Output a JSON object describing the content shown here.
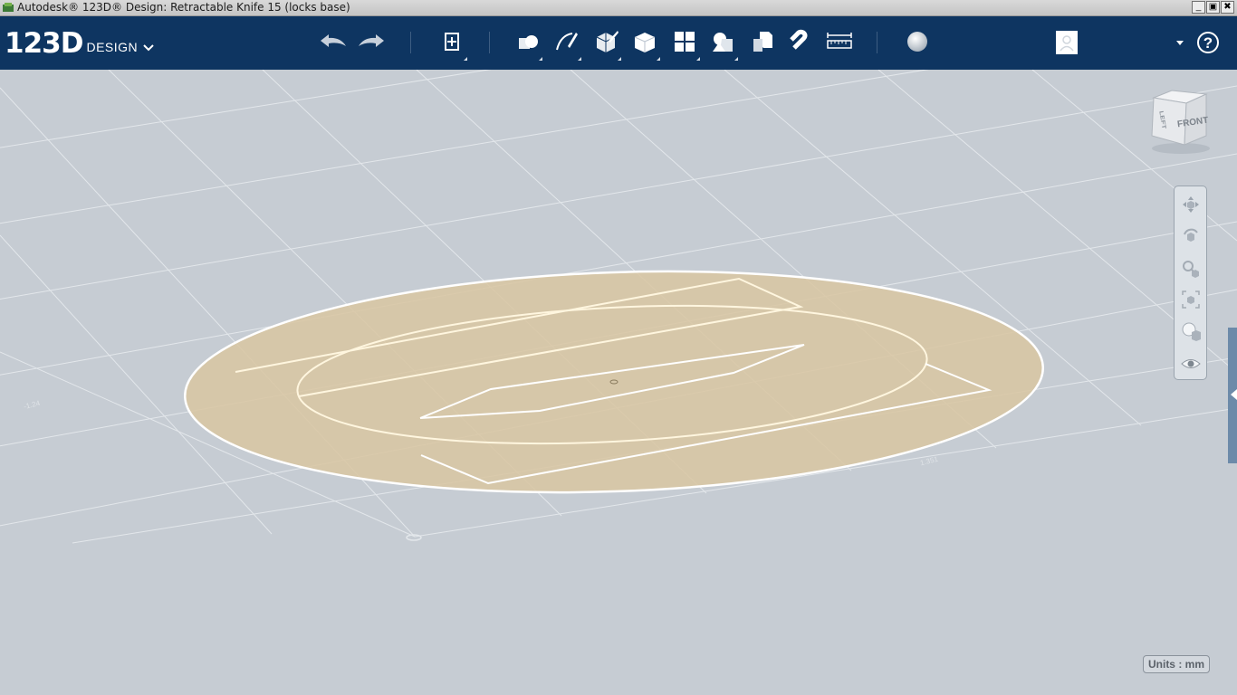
{
  "window": {
    "title": "Autodesk® 123D® Design: Retractable Knife 15 (locks base)",
    "buttons": [
      "_",
      "▣",
      "✖"
    ]
  },
  "app": {
    "logo_number": "123D",
    "logo_word": "DESIGN"
  },
  "toolbar": {
    "icons": [
      "undo-icon",
      "redo-icon",
      "transform-icon",
      "primitives-icon",
      "sketch-icon",
      "construct-icon",
      "modify-icon",
      "pattern-icon",
      "group-icon",
      "combine-icon",
      "snap-icon",
      "measure-icon",
      "material-icon",
      "account-icon",
      "help-icon"
    ],
    "help_label": "?"
  },
  "viewcube": {
    "left_face": "LEFT",
    "front_face": "FRONT"
  },
  "navbar": {
    "items": [
      "pan-icon",
      "orbit-icon",
      "zoom-icon",
      "fit-icon",
      "view-mode-icon",
      "visibility-icon"
    ]
  },
  "grid": {
    "label_left": "-1.24",
    "label_right": "1.351"
  },
  "status": {
    "units": "Units : mm"
  },
  "colors": {
    "toolbar": "#0e3561",
    "viewport": "#c6ccd3",
    "sketch_fill": "#d8c6a3",
    "sketch_line": "#fff6df"
  }
}
